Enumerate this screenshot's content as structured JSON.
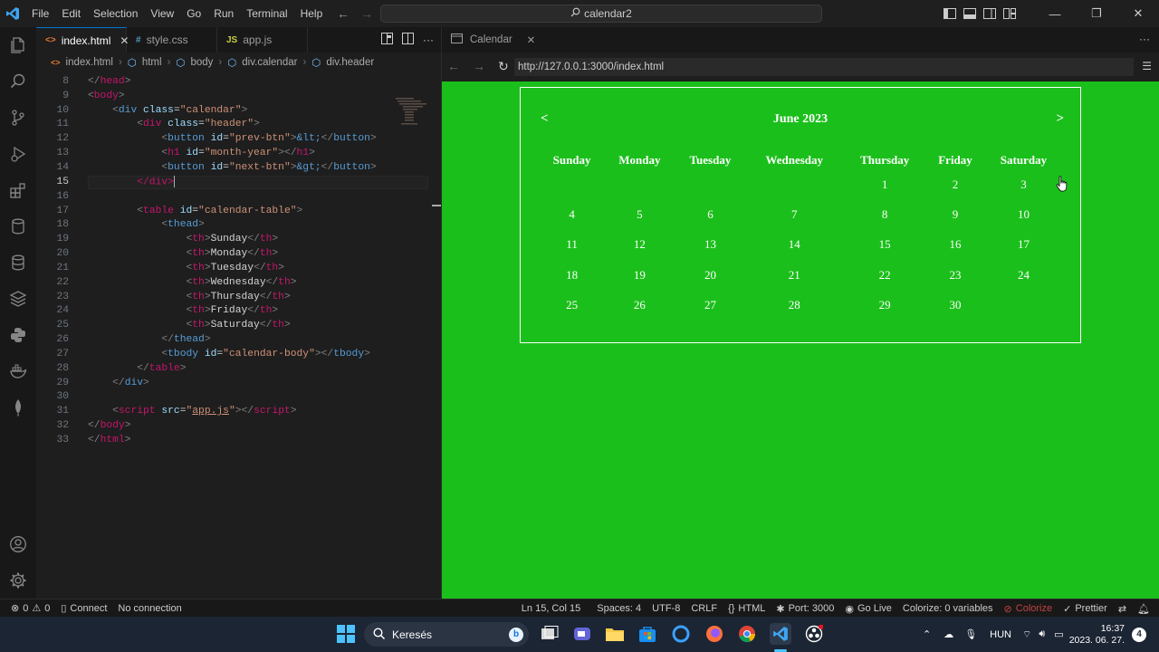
{
  "titlebar": {
    "menu": [
      "File",
      "Edit",
      "Selection",
      "View",
      "Go",
      "Run",
      "Terminal",
      "Help"
    ],
    "command_center": "calendar2"
  },
  "editor": {
    "tabs": [
      {
        "label": "index.html",
        "icon": "<>",
        "active": true
      },
      {
        "label": "style.css",
        "icon": "#",
        "active": false
      },
      {
        "label": "app.js",
        "icon": "JS",
        "active": false
      }
    ],
    "breadcrumb": [
      "index.html",
      "html",
      "body",
      "div.calendar",
      "div.header"
    ],
    "lines": [
      {
        "n": "8"
      },
      {
        "n": "9"
      },
      {
        "n": "10"
      },
      {
        "n": "11"
      },
      {
        "n": "12"
      },
      {
        "n": "13"
      },
      {
        "n": "14"
      },
      {
        "n": "15"
      },
      {
        "n": "16"
      },
      {
        "n": "17"
      },
      {
        "n": "18"
      },
      {
        "n": "19"
      },
      {
        "n": "20"
      },
      {
        "n": "21"
      },
      {
        "n": "22"
      },
      {
        "n": "23"
      },
      {
        "n": "24"
      },
      {
        "n": "25"
      },
      {
        "n": "26"
      },
      {
        "n": "27"
      },
      {
        "n": "28"
      },
      {
        "n": "29"
      },
      {
        "n": "30"
      },
      {
        "n": "31"
      },
      {
        "n": "32"
      },
      {
        "n": "33"
      }
    ],
    "code": {
      "l8": "head",
      "l9": "body",
      "l10_tag": "div",
      "l10_attr": "class",
      "l10_val": "\"calendar\"",
      "l11_tag": "div",
      "l11_attr": "class",
      "l11_val": "\"header\"",
      "l12_tag": "button",
      "l12_attr": "id",
      "l12_val": "\"prev-btn\"",
      "l12_ent": "&lt;",
      "l12_close": "button",
      "l13_tag": "h1",
      "l13_attr": "id",
      "l13_val": "\"month-year\"",
      "l13_close": "h1",
      "l14_tag": "button",
      "l14_attr": "id",
      "l14_val": "\"next-btn\"",
      "l14_ent": "&gt;",
      "l14_close": "button",
      "l15": "</div>",
      "l17_tag": "table",
      "l17_attr": "id",
      "l17_val": "\"calendar-table\"",
      "l18": "thead",
      "th_days": [
        "Sunday",
        "Monday",
        "Tuesday",
        "Wednesday",
        "Thursday",
        "Friday",
        "Saturday"
      ],
      "l26": "thead",
      "l27_tag": "tbody",
      "l27_attr": "id",
      "l27_val": "\"calendar-body\"",
      "l27_close": "tbody",
      "l28": "table",
      "l29": "div",
      "l31_tag": "script",
      "l31_attr": "src",
      "l31_val": "app.js",
      "l31_close": "script",
      "l32": "body",
      "l33": "html",
      "th": "th"
    }
  },
  "preview": {
    "tab_label": "Calendar",
    "url": "http://127.0.0.1:3000/index.html",
    "page_bg": "#1bbf1b",
    "calendar": {
      "prev": "<",
      "next": ">",
      "month_year": "June 2023",
      "headers": [
        "Sunday",
        "Monday",
        "Tuesday",
        "Wednesday",
        "Thursday",
        "Friday",
        "Saturday"
      ],
      "weeks": [
        [
          "",
          "",
          "",
          "",
          "1",
          "2",
          "3"
        ],
        [
          "4",
          "5",
          "6",
          "7",
          "8",
          "9",
          "10"
        ],
        [
          "11",
          "12",
          "13",
          "14",
          "15",
          "16",
          "17"
        ],
        [
          "18",
          "19",
          "20",
          "21",
          "22",
          "23",
          "24"
        ],
        [
          "25",
          "26",
          "27",
          "28",
          "29",
          "30",
          ""
        ]
      ]
    }
  },
  "statusbar": {
    "errors": "0",
    "warnings": "0",
    "connect": "Connect",
    "no_connection": "No connection",
    "position": "Ln 15, Col 15",
    "spaces": "Spaces: 4",
    "encoding": "UTF-8",
    "eol": "CRLF",
    "language": "HTML",
    "port": "Port: 3000",
    "golive": "Go Live",
    "colorize_vars": "Colorize: 0 variables",
    "colorize": "Colorize",
    "prettier": "Prettier"
  },
  "taskbar": {
    "search": "Keresés",
    "lang": "HUN",
    "time": "16:37",
    "date": "2023. 06. 27.",
    "notifications": "4"
  }
}
